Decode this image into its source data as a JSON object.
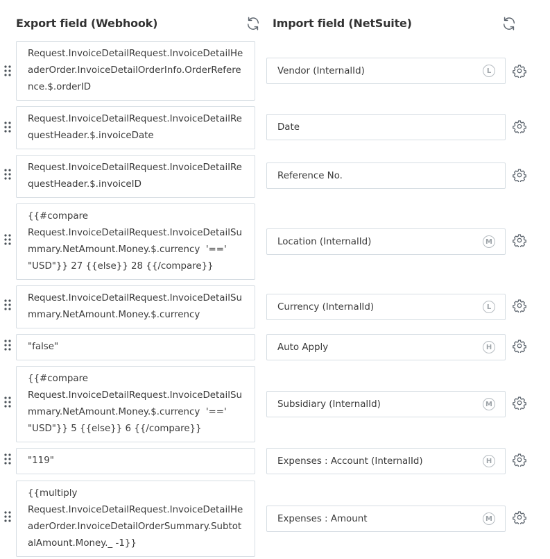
{
  "header": {
    "export_title": "Export field (Webhook)",
    "import_title": "Import field (NetSuite)"
  },
  "icons": {
    "refresh": "refresh-icon",
    "drag": "drag-handle-icon",
    "settings": "gear-icon"
  },
  "mappings": [
    {
      "export": "Request.InvoiceDetailRequest.InvoiceDetailHeaderOrder.InvoiceDetailOrderInfo.OrderReference.$.orderID",
      "import": "Vendor (InternalId)",
      "badge": "L"
    },
    {
      "export": "Request.InvoiceDetailRequest.InvoiceDetailRequestHeader.$.invoiceDate",
      "import": "Date",
      "badge": ""
    },
    {
      "export": "Request.InvoiceDetailRequest.InvoiceDetailRequestHeader.$.invoiceID",
      "import": "Reference No.",
      "badge": ""
    },
    {
      "export": "{{#compare\nRequest.InvoiceDetailRequest.InvoiceDetailSummary.NetAmount.Money.$.currency  '=='\n\"USD\"}} 27 {{else}} 28 {{/compare}}",
      "import": "Location (InternalId)",
      "badge": "M"
    },
    {
      "export": "Request.InvoiceDetailRequest.InvoiceDetailSummary.NetAmount.Money.$.currency",
      "import": "Currency (InternalId)",
      "badge": "L"
    },
    {
      "export": "\"false\"",
      "import": "Auto Apply",
      "badge": "H"
    },
    {
      "export": "{{#compare\nRequest.InvoiceDetailRequest.InvoiceDetailSummary.NetAmount.Money.$.currency  '=='\n\"USD\"}} 5 {{else}} 6 {{/compare}}",
      "import": "Subsidiary (InternalId)",
      "badge": "M"
    },
    {
      "export": "\"119\"",
      "import": "Expenses : Account (InternalId)",
      "badge": "H"
    },
    {
      "export": "{{multiply\nRequest.InvoiceDetailRequest.InvoiceDetailHeaderOrder.InvoiceDetailOrderSummary.SubtotalAmount.Money._ -1}}",
      "import": "Expenses : Amount",
      "badge": "M"
    }
  ]
}
